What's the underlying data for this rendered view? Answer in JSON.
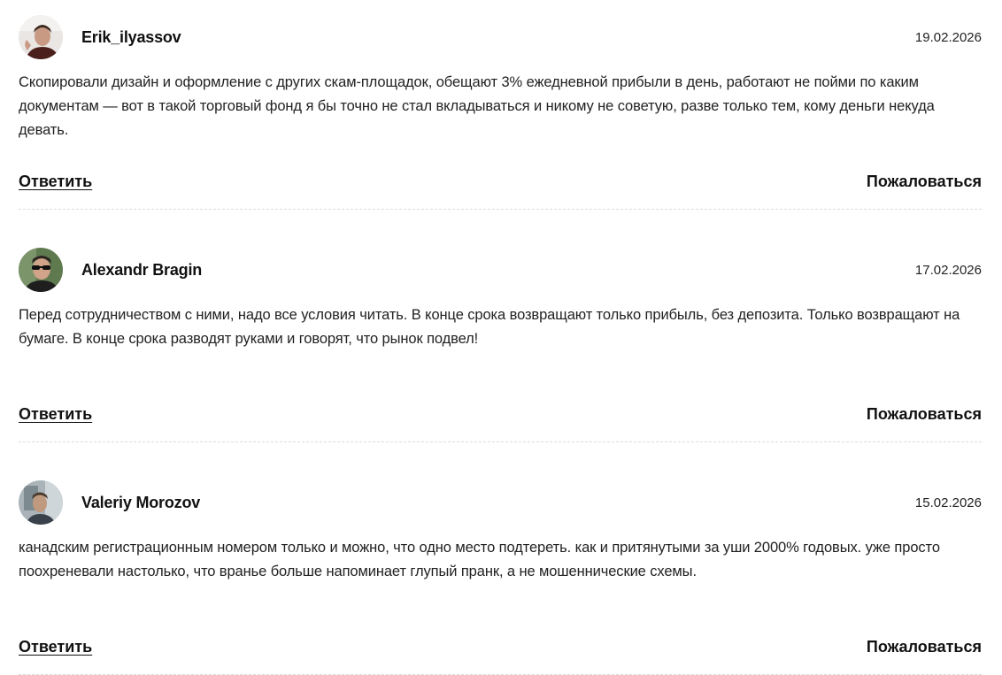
{
  "comments": [
    {
      "author": "Erik_ilyassov",
      "date": "19.02.2026",
      "text": "Скопировали дизайн и оформление с других скам-площадок, обещают 3% ежедневной прибыли в день, работают не пойми по каким документам — вот в такой торговый фонд я бы точно не стал вкладываться и никому не советую, разве только тем, кому деньги некуда девать.",
      "reply_label": "Ответить",
      "report_label": "Пожаловаться"
    },
    {
      "author": "Alexandr Bragin",
      "date": "17.02.2026",
      "text": "Перед сотрудничеством с ними, надо все условия читать. В конце срока возвращают только прибыль, без депозита. Только возвращают на бумаге. В конце срока разводят руками и говорят, что рынок подвел!",
      "reply_label": "Ответить",
      "report_label": "Пожаловаться"
    },
    {
      "author": "Valeriy Morozov",
      "date": "15.02.2026",
      "text": "канадским регистрационным номером только и можно, что одно место подтереть. как и притянутыми за уши 2000% годовых. уже просто поохреневали настолько, что вранье больше напоминает глупый пранк, а не мошеннические схемы.",
      "reply_label": "Ответить",
      "report_label": "Пожаловаться"
    }
  ]
}
